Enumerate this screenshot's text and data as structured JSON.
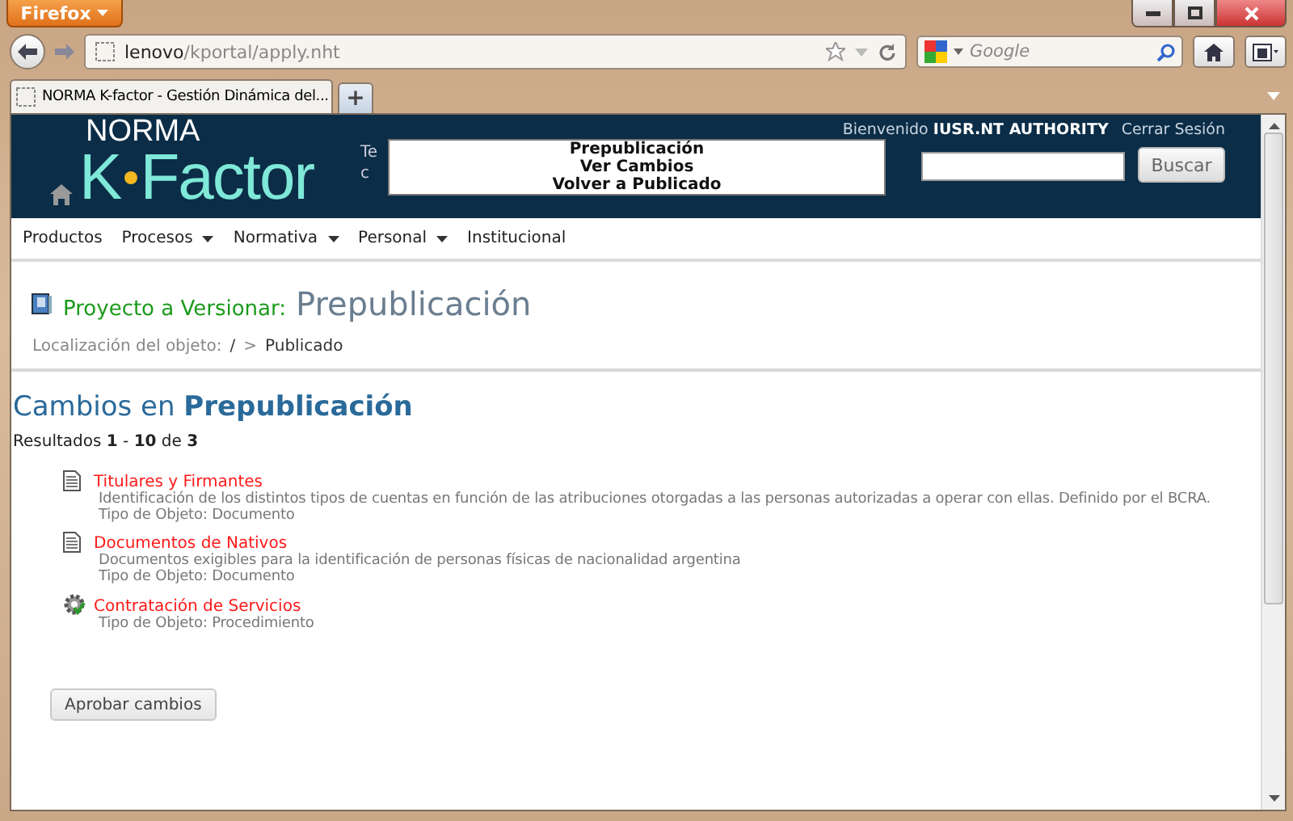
{
  "browser": {
    "app_button": "Firefox",
    "url_host": "lenovo",
    "url_path": "/kportal/apply.nht",
    "search_placeholder": "Google",
    "tabs": [
      {
        "label": "NORMA K-factor - Gestión Dinámica del...",
        "selected": true
      }
    ],
    "new_tab": "+"
  },
  "header": {
    "logo": {
      "top": "NORMA",
      "left": "K",
      "right": "Factor"
    },
    "tagline_fragments": [
      "Te",
      "c"
    ],
    "welcome": "Bienvenido",
    "user": "IUSR.NT AUTHORITY",
    "logout": "Cerrar Sesión",
    "search_button": "Buscar"
  },
  "popup_menu": [
    "Prepublicación",
    "Ver Cambios",
    "Volver a Publicado"
  ],
  "menu": [
    {
      "label": "Productos",
      "dropdown": false
    },
    {
      "label": "Procesos",
      "dropdown": true
    },
    {
      "label": "Normativa",
      "dropdown": true
    },
    {
      "label": "Personal",
      "dropdown": true
    },
    {
      "label": "Institucional",
      "dropdown": false
    }
  ],
  "project": {
    "label": "Proyecto a Versionar:",
    "name": "Prepublicación",
    "location_label": "Localización del objeto:",
    "location_root": "/",
    "location_sep": ">",
    "location_current": "Publicado"
  },
  "changes": {
    "title": "Cambios en **Prepublicación**",
    "results": "Resultados **1** - **10** de **3**",
    "items": [
      {
        "kind": "document",
        "title": "Titulares y Firmantes",
        "description": "Identificación de los distintos tipos de cuentas en función de las atribuciones otorgadas a las personas autorizadas a operar con ellas. Definido por el BCRA.",
        "type": "Tipo de Objeto: Documento"
      },
      {
        "kind": "document",
        "title": "Documentos de Nativos",
        "description": "Documentos exigibles para la identificación de personas físicas de nacionalidad argentina",
        "type": "Tipo de Objeto: Documento"
      },
      {
        "kind": "procedure",
        "title": "Contratación de Servicios",
        "type": "Tipo de Objeto: Procedimiento"
      }
    ],
    "approve_button": "Aprobar cambios"
  }
}
